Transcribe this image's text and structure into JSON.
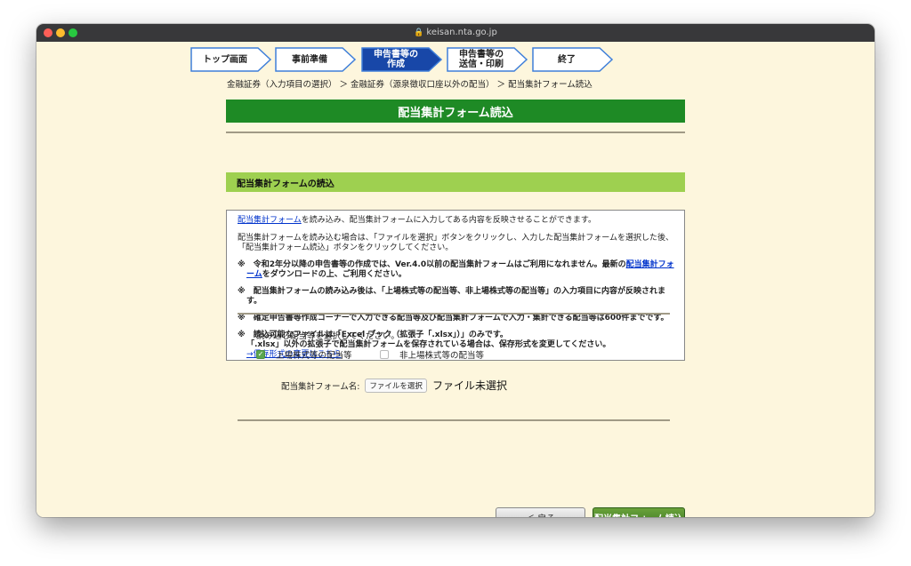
{
  "window": {
    "url": "keisan.nta.go.jp",
    "traffic_colors": [
      "#fe5f57",
      "#febc2e",
      "#28c840"
    ]
  },
  "steps": [
    {
      "label": "トップ画面",
      "active": false
    },
    {
      "label": "事前準備",
      "active": false
    },
    {
      "label": "申告書等の\n作成",
      "active": true
    },
    {
      "label": "申告書等の\n送信・印刷",
      "active": false
    },
    {
      "label": "終了",
      "active": false
    }
  ],
  "breadcrumb": "金融証券（入力項目の選択） ＞ 金融証券（源泉徴収口座以外の配当） ＞ 配当集計フォーム読込",
  "page_title": "配当集計フォーム読込",
  "section_title": "配当集計フォームの読込",
  "info": {
    "link1": "配当集計フォーム",
    "para1_rest": "を読み込み、配当集計フォームに入力してある内容を反映させることができます。",
    "para2": "配当集計フォームを読み込む場合は、「ファイルを選択」ボタンをクリックし、入力した配当集計フォームを選択した後、「配当集計フォーム読込」ボタンをクリックしてください。",
    "note1_pre": "※　令和2年分以降の申告書等の作成では、Ver.4.0以前の配当集計フォームはご利用になれません。最新の",
    "note1_link": "配当集計フォーム",
    "note1_post": "をダウンロードの上、ご利用ください。",
    "note2": "※　配当集計フォームの読み込み後は、「上場株式等の配当等、非上場株式等の配当等」の入力項目に内容が反映されます。",
    "note3": "※　確定申告書等作成コーナーで入力できる配当等及び配当集計フォームで入力・集計できる配当等は600件までです。",
    "note4_l1": "※　読込可能なファイルは「Excel ブック（拡張子「.xlsx」）」のみです。",
    "note4_l2": "「.xlsx」以外の拡張子で配当集計フォームを保存されている場合は、保存形式を変更してください。",
    "note4_link": "→保存形式の変更はこちら"
  },
  "select": {
    "prompt": "読み込む配当等を選択してください。",
    "listed_label": "上場株式等の配当等",
    "listed_checked": true,
    "unlisted_label": "非上場株式等の配当等",
    "unlisted_checked": false
  },
  "file": {
    "label": "配当集計フォーム名:",
    "button": "ファイルを選択",
    "status": "ファイル未選択"
  },
  "buttons": {
    "back": "＜ 戻る",
    "submit": "配当集計フォーム読込"
  },
  "colors": {
    "page_bg": "#fdf6dd",
    "title_green": "#1e8a25",
    "section_green": "#9ed050",
    "active_step": "#1847a8",
    "step_border": "#3f7fd9"
  }
}
